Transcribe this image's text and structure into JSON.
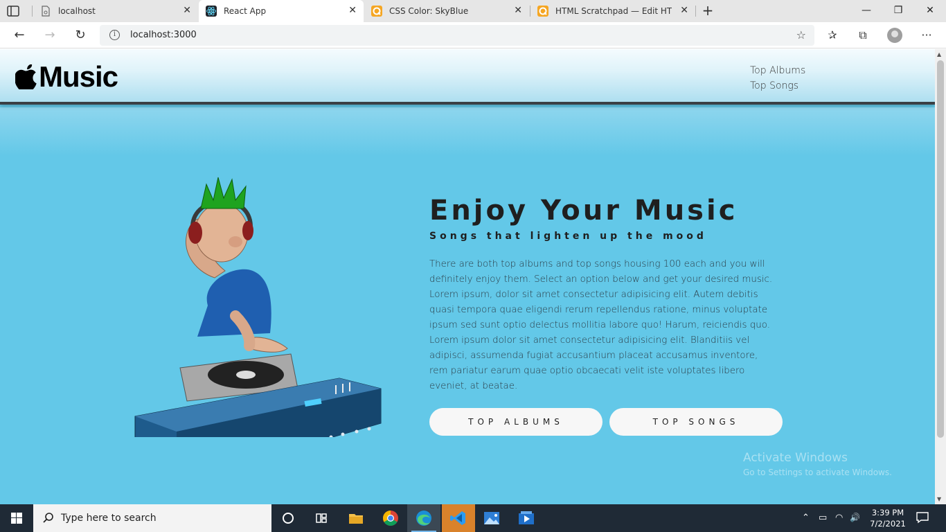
{
  "browser": {
    "tabs": [
      {
        "title": "localhost",
        "active": false
      },
      {
        "title": "React App",
        "active": true
      },
      {
        "title": "CSS Color: SkyBlue",
        "active": false
      },
      {
        "title": "HTML Scratchpad — Edit HTML /",
        "active": false
      }
    ],
    "close_glyph": "✕",
    "new_tab_glyph": "+",
    "window_controls": {
      "minimize": "—",
      "restore": "❐",
      "close": "✕"
    },
    "url": "localhost:3000",
    "nav": {
      "back": "←",
      "forward": "→",
      "reload": "↻"
    },
    "toolbar_icons": {
      "add_favorite": "☆",
      "favorites": "✰",
      "collections": "⧉",
      "more": "···"
    }
  },
  "site": {
    "logo_text": "Music",
    "nav": {
      "top_albums": "Top Albums",
      "top_songs": "Top Songs"
    },
    "hero": {
      "title": "Enjoy Your Music",
      "subtitle": "Songs that lighten up the mood",
      "body": "There are both top albums and top songs housing 100 each and you will definitely enjoy them. Select an option below and get your desired music. Lorem ipsum, dolor sit amet consectetur adipisicing elit. Autem debitis quasi tempora quae eligendi rerum repellendus ratione, minus voluptate ipsum sed sunt optio delectus mollitia labore quo! Harum, reiciendis quo. Lorem ipsum dolor sit amet consectetur adipisicing elit. Blanditiis vel adipisci, assumenda fugiat accusantium placeat accusamus inventore, rem pariatur earum quae optio obcaecati velit iste voluptates libero eveniet, at beatae.",
      "button_albums": "TOP ALBUMS",
      "button_songs": "TOP SONGS"
    },
    "background_color": "#63c8e8"
  },
  "watermark": {
    "line1": "Activate Windows",
    "line2": "Go to Settings to activate Windows."
  },
  "taskbar": {
    "search_placeholder": "Type here to search",
    "time": "3:39 PM",
    "date": "7/2/2021",
    "tray_icons": {
      "chevron": "⌃",
      "battery": "▭",
      "wifi": "◠",
      "volume": "🔊"
    }
  }
}
